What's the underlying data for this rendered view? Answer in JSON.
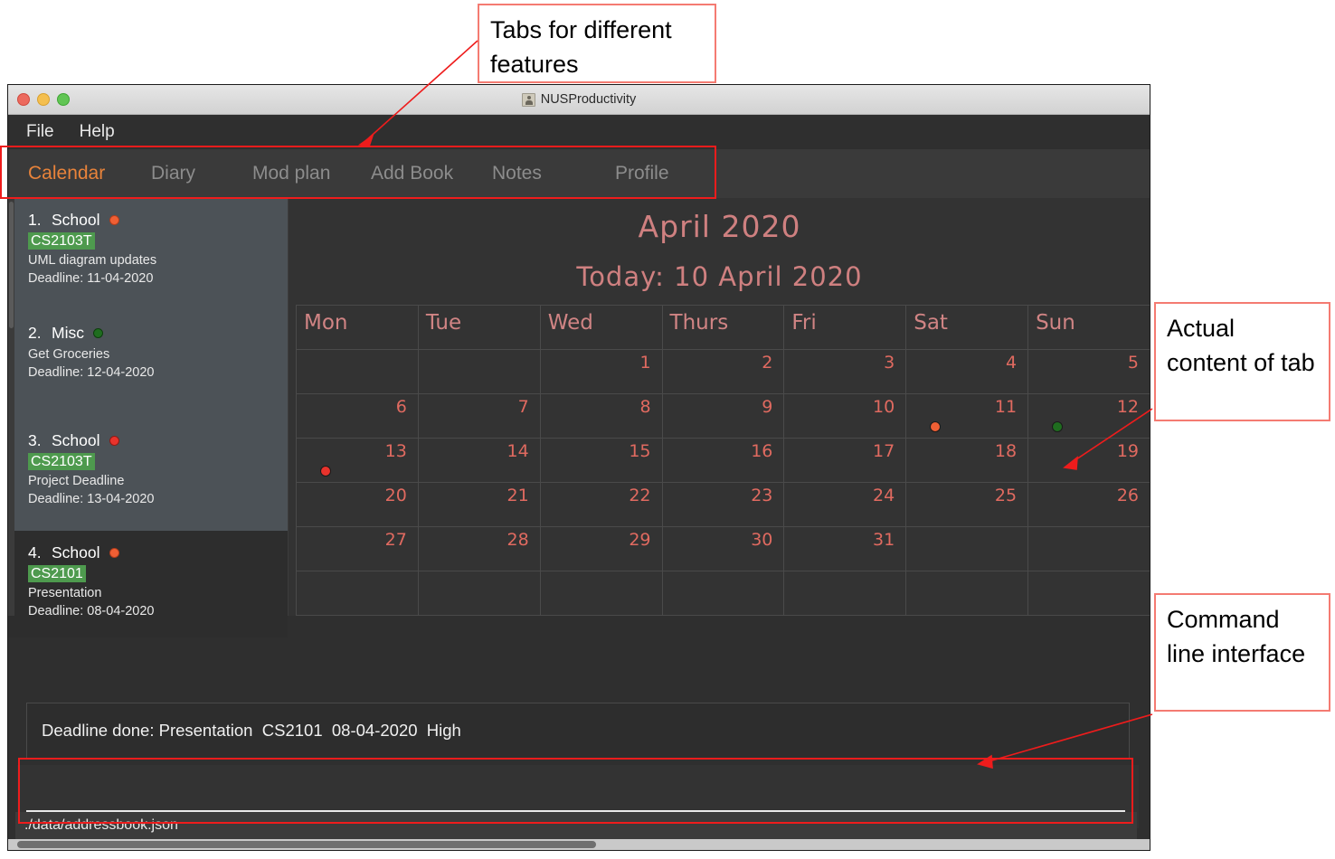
{
  "window": {
    "title": "NUSProductivity",
    "menu": [
      "File",
      "Help"
    ],
    "traffic_lights": [
      "close",
      "minimize",
      "zoom"
    ]
  },
  "tabs": [
    {
      "label": "Calendar",
      "active": true
    },
    {
      "label": "Diary",
      "active": false
    },
    {
      "label": "Mod plan",
      "active": false
    },
    {
      "label": "Add Book",
      "active": false
    },
    {
      "label": "Notes",
      "active": false
    },
    {
      "label": "Profile",
      "active": false
    }
  ],
  "sidebar": {
    "tasks": [
      {
        "index": "1.",
        "category": "School",
        "priority_color": "#ef5f34",
        "module": "CS2103T",
        "description": "UML diagram updates",
        "deadline": "Deadline: 11-04-2020",
        "selected": true
      },
      {
        "index": "2.",
        "category": "Misc",
        "priority_color": "#1f6d1f",
        "module": null,
        "description": "Get Groceries",
        "deadline": "Deadline: 12-04-2020",
        "selected": true
      },
      {
        "index": "3.",
        "category": "School",
        "priority_color": "#e8332c",
        "module": "CS2103T",
        "description": "Project Deadline",
        "deadline": "Deadline: 13-04-2020",
        "selected": true
      },
      {
        "index": "4.",
        "category": "School",
        "priority_color": "#ef5f34",
        "module": "CS2101",
        "description": "Presentation",
        "deadline": "Deadline: 08-04-2020",
        "selected": false
      }
    ]
  },
  "calendar": {
    "month_title": "April 2020",
    "today_title": "Today: 10 April 2020",
    "day_headers": [
      "Mon",
      "Tue",
      "Wed",
      "Thurs",
      "Fri",
      "Sat",
      "Sun"
    ],
    "weeks": [
      [
        {
          "day": ""
        },
        {
          "day": ""
        },
        {
          "day": "1"
        },
        {
          "day": "2"
        },
        {
          "day": "3"
        },
        {
          "day": "4"
        },
        {
          "day": "5"
        }
      ],
      [
        {
          "day": "6"
        },
        {
          "day": "7"
        },
        {
          "day": "8"
        },
        {
          "day": "9"
        },
        {
          "day": "10"
        },
        {
          "day": "11",
          "dot": "#ef5f34"
        },
        {
          "day": "12",
          "dot": "#1f6d1f"
        }
      ],
      [
        {
          "day": "13",
          "dot": "#e8332c"
        },
        {
          "day": "14"
        },
        {
          "day": "15"
        },
        {
          "day": "16"
        },
        {
          "day": "17"
        },
        {
          "day": "18"
        },
        {
          "day": "19"
        }
      ],
      [
        {
          "day": "20"
        },
        {
          "day": "21"
        },
        {
          "day": "22"
        },
        {
          "day": "23"
        },
        {
          "day": "24"
        },
        {
          "day": "25"
        },
        {
          "day": "26"
        }
      ],
      [
        {
          "day": "27"
        },
        {
          "day": "28"
        },
        {
          "day": "29"
        },
        {
          "day": "30"
        },
        {
          "day": "31"
        },
        {
          "day": ""
        },
        {
          "day": ""
        }
      ],
      [
        {
          "day": ""
        },
        {
          "day": ""
        },
        {
          "day": ""
        },
        {
          "day": ""
        },
        {
          "day": ""
        },
        {
          "day": ""
        },
        {
          "day": ""
        }
      ]
    ]
  },
  "result": {
    "text": "Deadline done: Presentation  CS2101  08-04-2020  High"
  },
  "command": {
    "value": "",
    "placeholder": ""
  },
  "status": {
    "file_path": "./data/addressbook.json"
  },
  "annotations": [
    {
      "id": "tabs",
      "text": "Tabs for different features"
    },
    {
      "id": "content",
      "text": "Actual content of tab"
    },
    {
      "id": "cli",
      "text": "Command line interface"
    }
  ],
  "colors": {
    "accent_tab": "#e8833a",
    "calendar_text": "#cf8080",
    "day_number": "#e06a60",
    "annotation_border": "#ee1c1c",
    "annotation_box_border": "#f47b72",
    "module_tag_bg": "#4e9a4e"
  }
}
